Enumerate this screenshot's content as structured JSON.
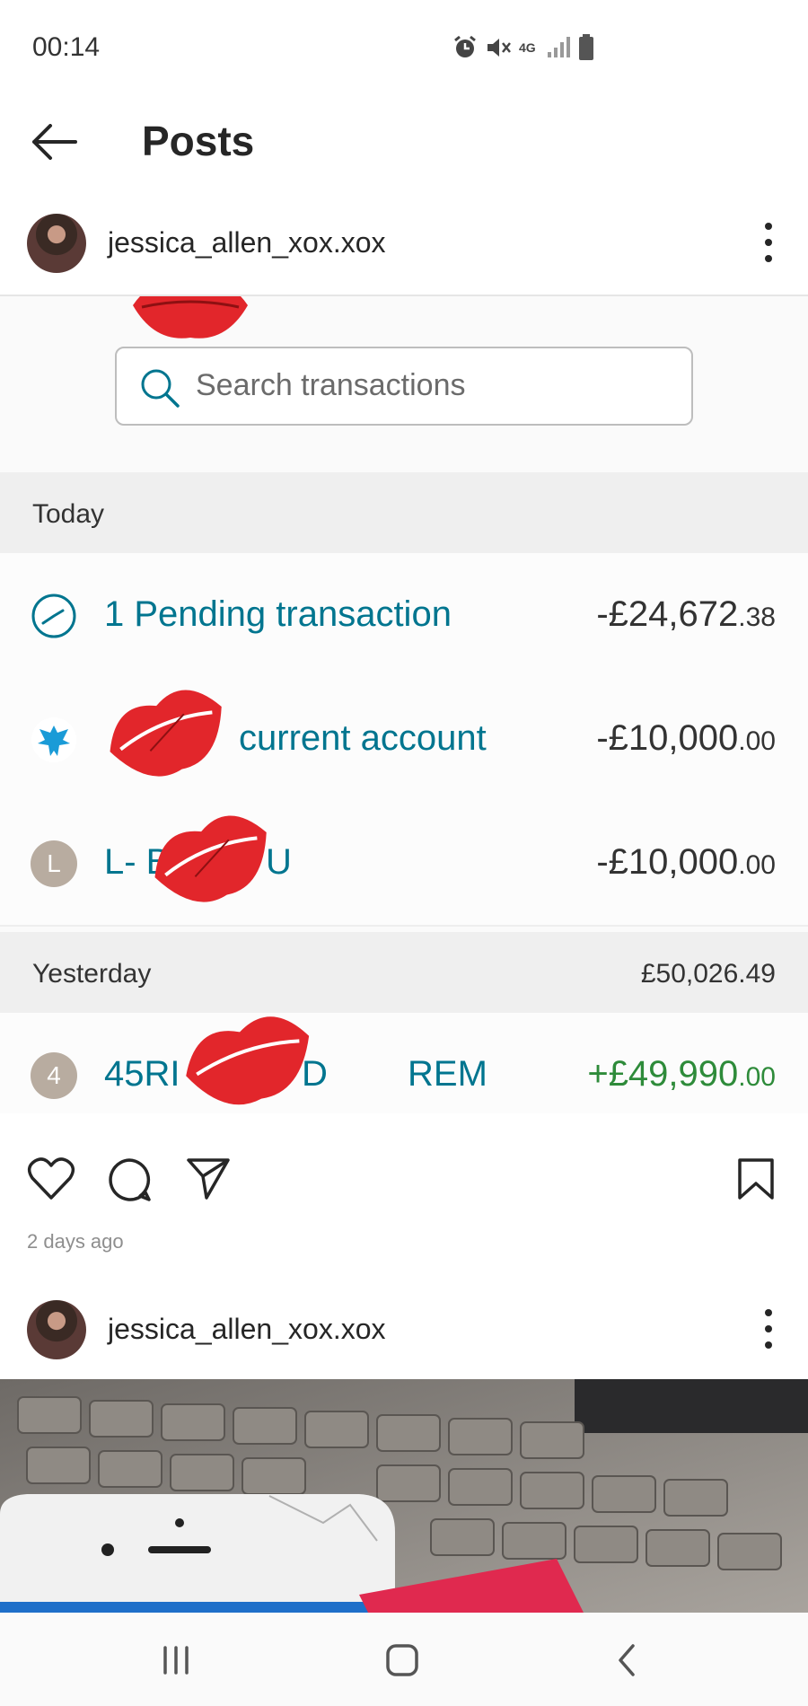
{
  "status_bar": {
    "time": "00:14",
    "network": "4G"
  },
  "top_bar": {
    "title": "Posts"
  },
  "post1": {
    "username": "jessica_allen_xox.xox",
    "image": {
      "search_placeholder": "Search transactions",
      "sections": [
        {
          "label": "Today",
          "total": "",
          "transactions": [
            {
              "name": "1 Pending transaction",
              "amount_main": "-£24,672",
              "amount_cents": ".38"
            },
            {
              "name": "current account",
              "amount_main": "-£10,000",
              "amount_cents": ".00"
            },
            {
              "name": "L- B",
              "name_tail": "U",
              "amount_main": "-£10,000",
              "amount_cents": ".00"
            }
          ]
        },
        {
          "label": "Yesterday",
          "total": "£50,026.49",
          "transactions": [
            {
              "name": "45RI",
              "name_tail": "D",
              "name_ref": "REM",
              "amount_main": "+£49,990",
              "amount_cents": ".00"
            }
          ]
        }
      ]
    },
    "timestamp": "2 days ago"
  },
  "post2": {
    "username": "jessica_allen_xox.xox"
  },
  "colors": {
    "link_teal": "#00758f",
    "credit_green": "#2e8b3a",
    "kiss_red": "#e2262b"
  }
}
